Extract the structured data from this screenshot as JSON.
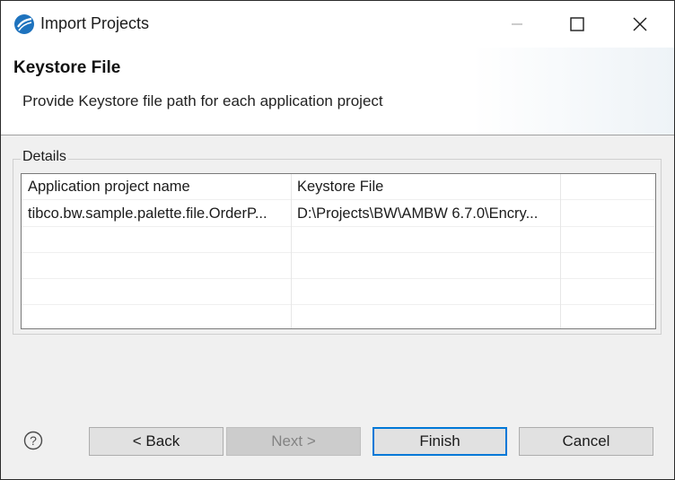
{
  "window": {
    "title": "Import Projects",
    "controls": {
      "minimize_icon": "minimize-icon",
      "maximize_icon": "maximize-icon",
      "close_icon": "close-icon"
    }
  },
  "banner": {
    "title": "Keystore File",
    "description": "Provide Keystore file path for each application project"
  },
  "details": {
    "label": "Details",
    "columns": [
      "Application project name",
      "Keystore File"
    ],
    "rows": [
      [
        "tibco.bw.sample.palette.file.OrderP...",
        "D:\\Projects\\BW\\AMBW 6.7.0\\Encry..."
      ]
    ]
  },
  "buttons": {
    "help_icon": "help-icon",
    "back": "< Back",
    "next": "Next >",
    "finish": "Finish",
    "cancel": "Cancel"
  },
  "colors": {
    "accent": "#0078d7",
    "window_bg": "#f0f0f0",
    "banner_bg": "#ffffff"
  }
}
